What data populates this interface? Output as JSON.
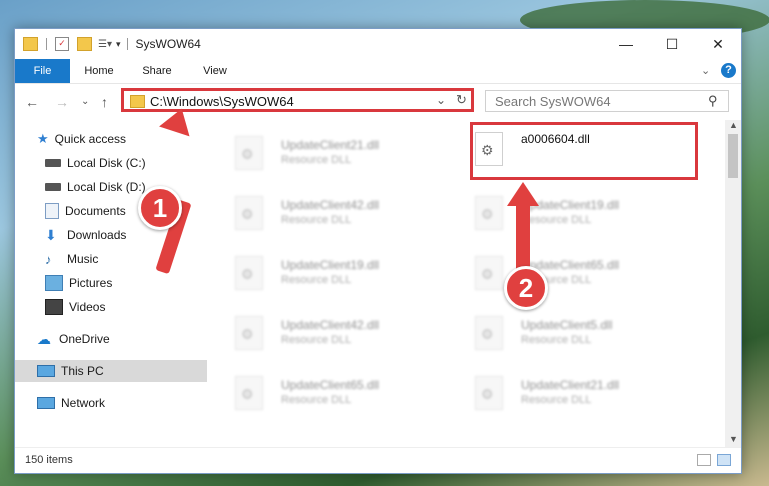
{
  "window": {
    "title": "SysWOW64"
  },
  "ribbon": {
    "tabs": [
      "File",
      "Home",
      "Share",
      "View"
    ]
  },
  "address": {
    "path": "C:\\Windows\\SysWOW64"
  },
  "search": {
    "placeholder": "Search SysWOW64"
  },
  "sidebar": {
    "items": [
      {
        "label": "Quick access",
        "icon": "star-icon"
      },
      {
        "label": "Local Disk (C:)",
        "icon": "drive-icon",
        "pinned": true
      },
      {
        "label": "Local Disk (D:)",
        "icon": "drive-icon",
        "pinned": true
      },
      {
        "label": "Documents",
        "icon": "documents-icon",
        "pinned": true
      },
      {
        "label": "Downloads",
        "icon": "download-icon",
        "pinned": true
      },
      {
        "label": "Music",
        "icon": "music-icon",
        "pinned": true
      },
      {
        "label": "Pictures",
        "icon": "pictures-icon",
        "pinned": true
      },
      {
        "label": "Videos",
        "icon": "videos-icon",
        "pinned": true
      },
      {
        "label": "OneDrive",
        "icon": "cloud-icon"
      },
      {
        "label": "This PC",
        "icon": "computer-icon",
        "selected": true
      },
      {
        "label": "Network",
        "icon": "network-icon"
      }
    ]
  },
  "files": {
    "highlighted": {
      "name": "a0006604.dll"
    },
    "blurred": [
      {
        "name": "UpdateClient21.dll",
        "type": "Resource DLL"
      },
      {
        "name": "UpdateClient42.dll",
        "type": "Resource DLL"
      },
      {
        "name": "UpdateClient19.dll",
        "type": "Resource DLL"
      },
      {
        "name": "UpdateClient19.dll",
        "type": "Resource DLL"
      },
      {
        "name": "UpdateClient65.dll",
        "type": "Resource DLL"
      },
      {
        "name": "UpdateClient42.dll",
        "type": "Resource DLL"
      },
      {
        "name": "UpdateClient5.dll",
        "type": "Resource DLL"
      },
      {
        "name": "UpdateClient65.dll",
        "type": "Resource DLL"
      },
      {
        "name": "UpdateClient21.dll",
        "type": "Resource DLL"
      }
    ]
  },
  "status": {
    "item_count": "150 items"
  },
  "callouts": {
    "one": "1",
    "two": "2"
  },
  "colors": {
    "accent": "#1979ca",
    "callout": "#e0403f"
  }
}
